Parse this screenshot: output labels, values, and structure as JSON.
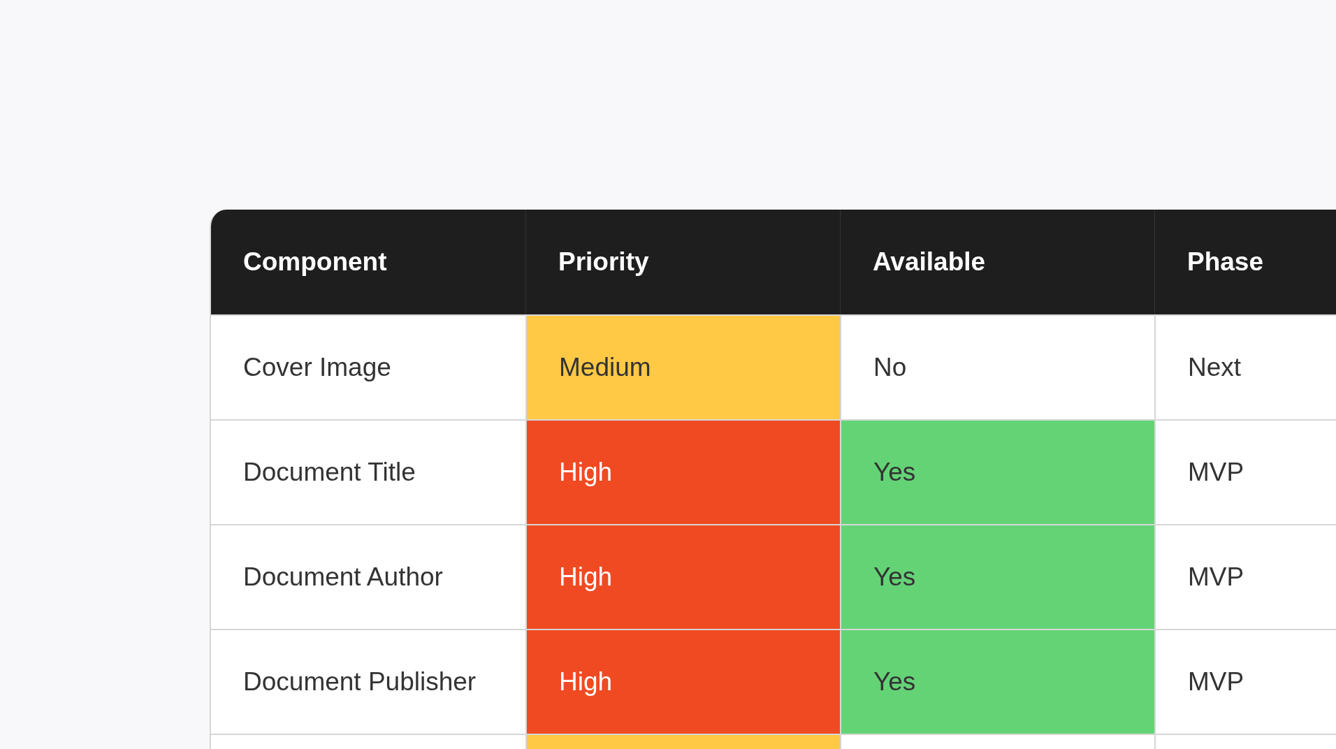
{
  "table": {
    "columns": [
      "Component",
      "Priority",
      "Available",
      "Phase"
    ],
    "rows": [
      {
        "cells": [
          {
            "text": "Cover Image"
          },
          {
            "text": "Medium",
            "color": "#ffc845"
          },
          {
            "text": "No"
          },
          {
            "text": "Next"
          }
        ]
      },
      {
        "cells": [
          {
            "text": "Document Title"
          },
          {
            "text": "High",
            "color": "#f04a22"
          },
          {
            "text": "Yes",
            "color": "#64d376"
          },
          {
            "text": "MVP"
          }
        ]
      },
      {
        "cells": [
          {
            "text": "Document Author"
          },
          {
            "text": "High",
            "color": "#f04a22"
          },
          {
            "text": "Yes",
            "color": "#64d376"
          },
          {
            "text": "MVP"
          }
        ]
      },
      {
        "cells": [
          {
            "text": "Document Publisher"
          },
          {
            "text": "High",
            "color": "#f04a22"
          },
          {
            "text": "Yes",
            "color": "#64d376"
          },
          {
            "text": "MVP"
          }
        ]
      },
      {
        "cells": [
          {},
          {
            "color": "#ffc845"
          },
          {},
          {}
        ]
      }
    ]
  }
}
